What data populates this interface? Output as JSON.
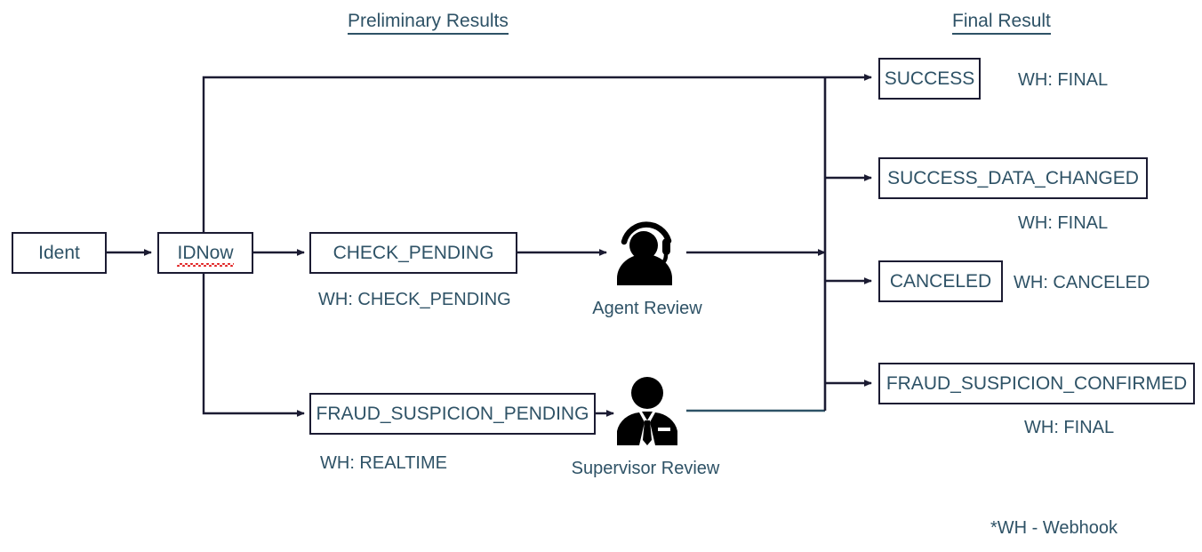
{
  "diagram": {
    "title_preliminary": "Preliminary Results",
    "title_final": "Final Result",
    "footnote": "*WH - Webhook",
    "colors": {
      "text": "#2e5266",
      "border": "#1b1b32",
      "connector": "#1b1b32",
      "connector_alt": "#2e5266",
      "spellcheck": "#e02020",
      "icon": "#000000",
      "background": "#ffffff"
    }
  },
  "nodes": {
    "ident": {
      "label": "Ident"
    },
    "idnow": {
      "label": "IDNow",
      "spellchecked": true
    },
    "check_pending": {
      "label": "CHECK_PENDING"
    },
    "fraud_suspicion_pending": {
      "label": "FRAUD_SUSPICION_PENDING"
    },
    "success": {
      "label": "SUCCESS"
    },
    "success_data_changed": {
      "label": "SUCCESS_DATA_CHANGED"
    },
    "canceled": {
      "label": "CANCELED"
    },
    "fraud_suspicion_confirmed": {
      "label": "FRAUD_SUSPICION_CONFIRMED"
    }
  },
  "webhooks": {
    "check_pending": "WH: CHECK_PENDING",
    "realtime": "WH: REALTIME",
    "success": "WH: FINAL",
    "success_data_changed": "WH: FINAL",
    "canceled": "WH: CANCELED",
    "fraud_suspicion_confirmed": "WH: FINAL"
  },
  "actors": {
    "agent": {
      "label": "Agent Review",
      "icon": "agent-headset-icon"
    },
    "supervisor": {
      "label": "Supervisor Review",
      "icon": "supervisor-suit-icon"
    }
  }
}
